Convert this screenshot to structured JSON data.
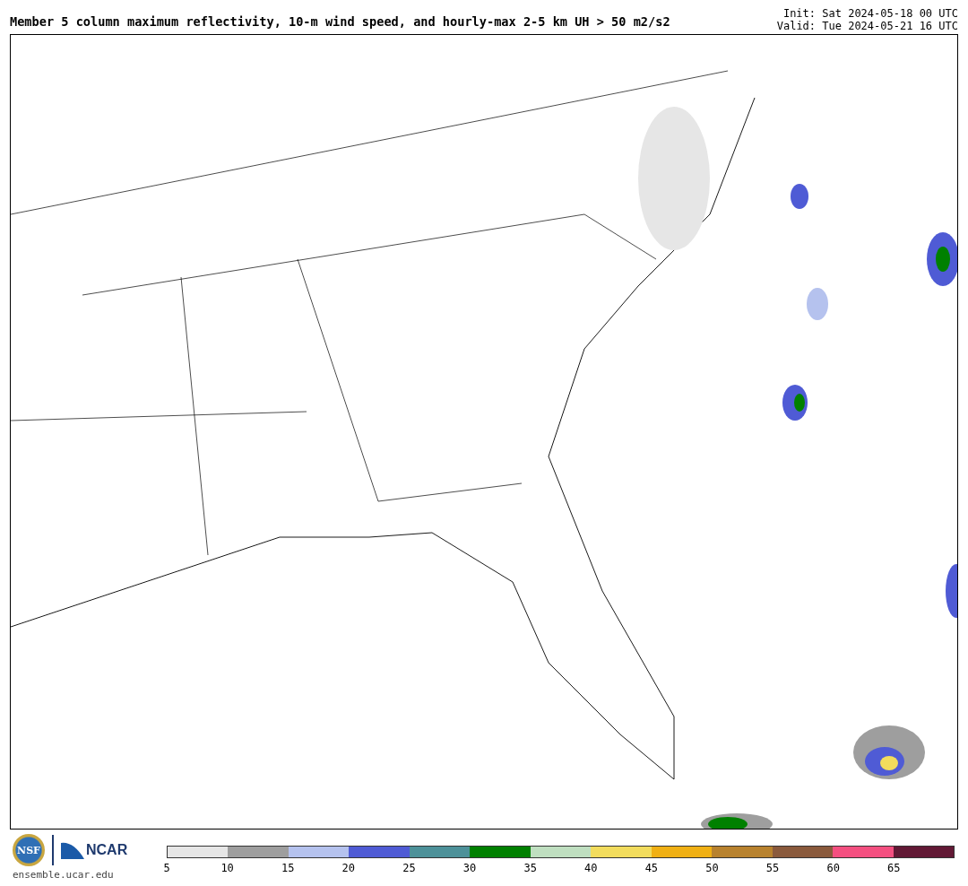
{
  "title": "Member 5 column maximum reflectivity, 10-m wind speed, and hourly-max 2-5 km UH > 50 m2/s2",
  "init": "Init: Sat 2024-05-18 00 UTC",
  "valid": "Valid: Tue 2024-05-21 16 UTC",
  "logos": {
    "nsf": "NSF",
    "ncar": "NCAR",
    "url": "ensemble.ucar.edu"
  },
  "colorbar": {
    "segments": [
      {
        "color": "#e6e6e6"
      },
      {
        "color": "#9e9e9e"
      },
      {
        "color": "#b5c2ee"
      },
      {
        "color": "#4f5bd5"
      },
      {
        "color": "#4d9199"
      },
      {
        "color": "#008000"
      },
      {
        "color": "#bfdfc0"
      },
      {
        "color": "#f2dc5d"
      },
      {
        "color": "#f0b014"
      },
      {
        "color": "#b8822e"
      },
      {
        "color": "#8a5a3c"
      },
      {
        "color": "#f44f80"
      },
      {
        "color": "#621935"
      }
    ],
    "ticks": [
      "5",
      "10",
      "15",
      "20",
      "25",
      "30",
      "35",
      "40",
      "45",
      "50",
      "55",
      "60",
      "65"
    ]
  }
}
